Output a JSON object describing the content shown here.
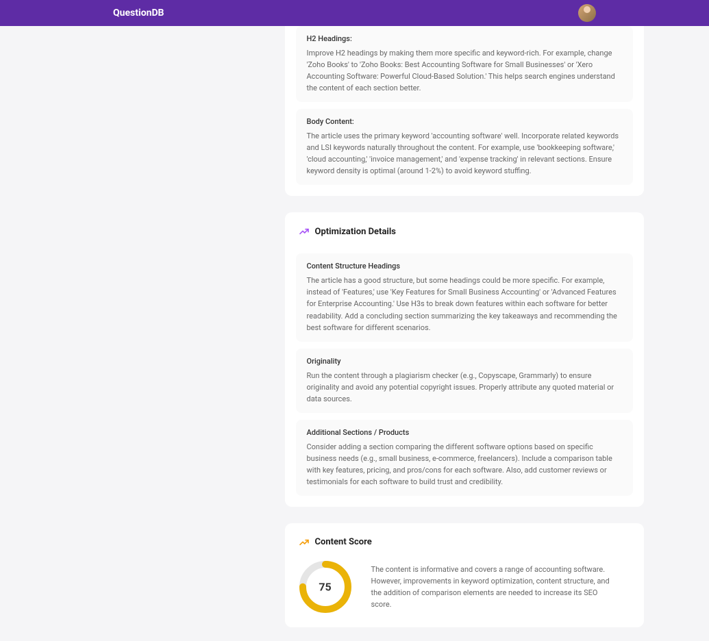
{
  "header": {
    "logo": "QuestionDB"
  },
  "keyword_panel": {
    "sections": [
      {
        "label": "H2 Headings:",
        "text": "Improve H2 headings by making them more specific and keyword-rich. For example, change 'Zoho Books' to 'Zoho Books: Best Accounting Software for Small Businesses' or 'Xero Accounting Software: Powerful Cloud-Based Solution.' This helps search engines understand the content of each section better."
      },
      {
        "label": "Body Content:",
        "text": "The article uses the primary keyword 'accounting software' well. Incorporate related keywords and LSI keywords naturally throughout the content. For example, use 'bookkeeping software,' 'cloud accounting,' 'invoice management,' and 'expense tracking' in relevant sections. Ensure keyword density is optimal (around 1-2%) to avoid keyword stuffing."
      }
    ]
  },
  "optimization_panel": {
    "title": "Optimization Details",
    "sections": [
      {
        "label": "Content Structure Headings",
        "text": "The article has a good structure, but some headings could be more specific. For example, instead of 'Features,' use 'Key Features for Small Business Accounting' or 'Advanced Features for Enterprise Accounting.' Use H3s to break down features within each software for better readability. Add a concluding section summarizing the key takeaways and recommending the best software for different scenarios."
      },
      {
        "label": "Originality",
        "text": "Run the content through a plagiarism checker (e.g., Copyscape, Grammarly) to ensure originality and avoid any potential copyright issues. Properly attribute any quoted material or data sources."
      },
      {
        "label": "Additional Sections / Products",
        "text": "Consider adding a section comparing the different software options based on specific business needs (e.g., small business, e-commerce, freelancers). Include a comparison table with key features, pricing, and pros/cons for each software. Also, add customer reviews or testimonials for each software to build trust and credibility."
      }
    ]
  },
  "score_panel": {
    "title": "Content Score",
    "value": "75",
    "percent": 75,
    "text": "The content is informative and covers a range of accounting software. However, improvements in keyword optimization, content structure, and the addition of comparison elements are needed to increase its SEO score."
  }
}
